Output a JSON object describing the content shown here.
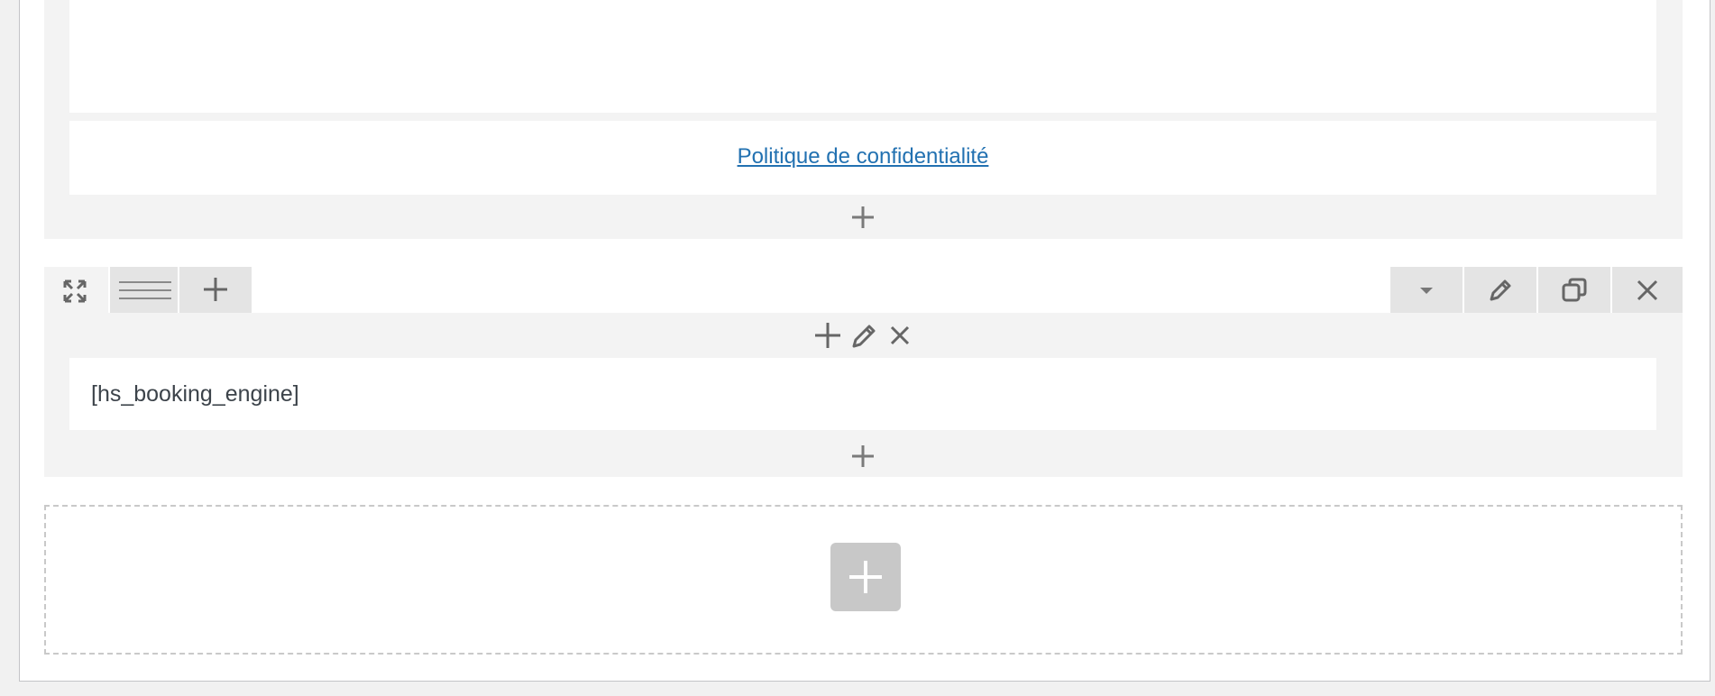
{
  "sections": [
    {
      "link_text": "Politique de confidentialité"
    },
    {
      "shortcode": "[hs_booking_engine]"
    }
  ],
  "icons": {
    "expand": "expand-icon",
    "drag": "drag-handle-icon",
    "add": "plus-icon",
    "dropdown": "caret-down-icon",
    "edit": "pencil-icon",
    "duplicate": "duplicate-icon",
    "delete": "close-icon"
  },
  "colors": {
    "link": "#2271b1",
    "section_bg": "#f3f3f3",
    "toolbar_btn": "#e4e4e4",
    "add_row_btn": "#c8c8c8"
  }
}
